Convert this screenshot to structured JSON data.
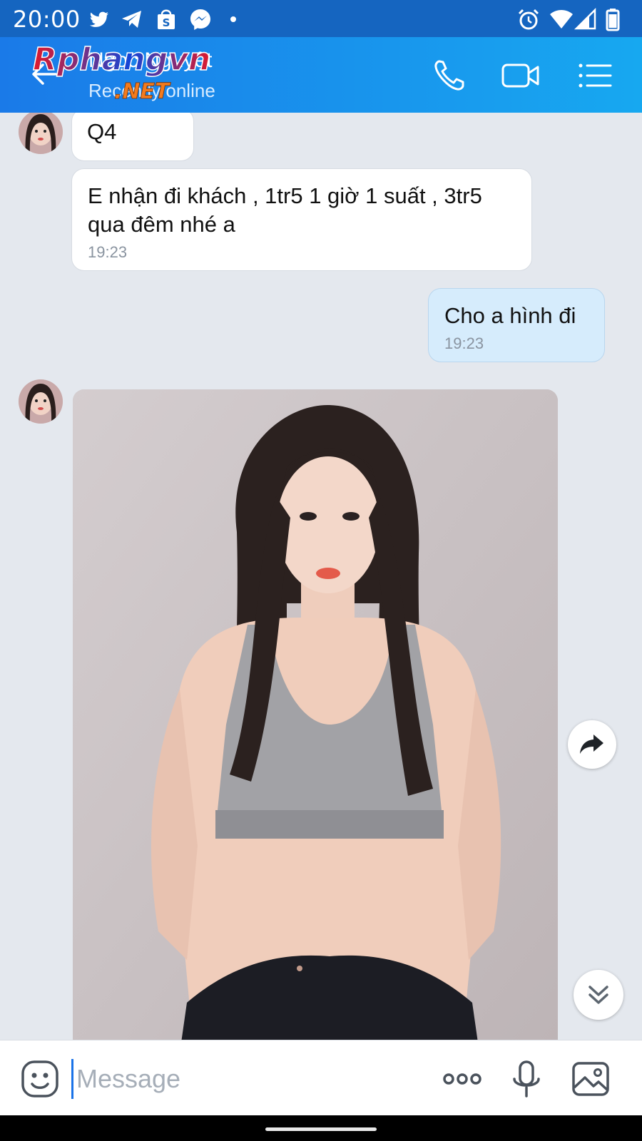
{
  "status_bar": {
    "time": "20:00",
    "left_icons": [
      "twitter-icon",
      "telegram-icon",
      "shopee-icon",
      "messenger-icon",
      "dot-icon"
    ],
    "right_icons": [
      "alarm-icon",
      "wifi-icon",
      "signal-icon",
      "battery-icon"
    ]
  },
  "header": {
    "contact_name": "Ngọc Nguyệt",
    "contact_status": "Recently online",
    "watermark_text": "Rphangvn .NET",
    "actions": [
      "phone-icon",
      "video-call-icon",
      "menu-icon"
    ]
  },
  "messages": [
    {
      "direction": "in",
      "text": "Q4",
      "time": ""
    },
    {
      "direction": "in",
      "text": "E nhận đi khách , 1tr5 1 giờ 1 suất , 3tr5 qua đêm nhé a",
      "time": "19:23"
    },
    {
      "direction": "out",
      "text": "Cho a hình đi",
      "time": "19:23"
    },
    {
      "direction": "in",
      "type": "photo"
    }
  ],
  "composer": {
    "placeholder": "Message",
    "buttons": [
      "emoji-icon",
      "more-icon",
      "microphone-icon",
      "gallery-icon"
    ]
  },
  "colors": {
    "status_bar": "#1565c0",
    "header_start": "#1a7ae8",
    "header_end": "#17a8f0",
    "chat_background": "#e4e8ee",
    "outgoing_bubble": "#d6ecfc",
    "incoming_bubble": "#ffffff"
  }
}
